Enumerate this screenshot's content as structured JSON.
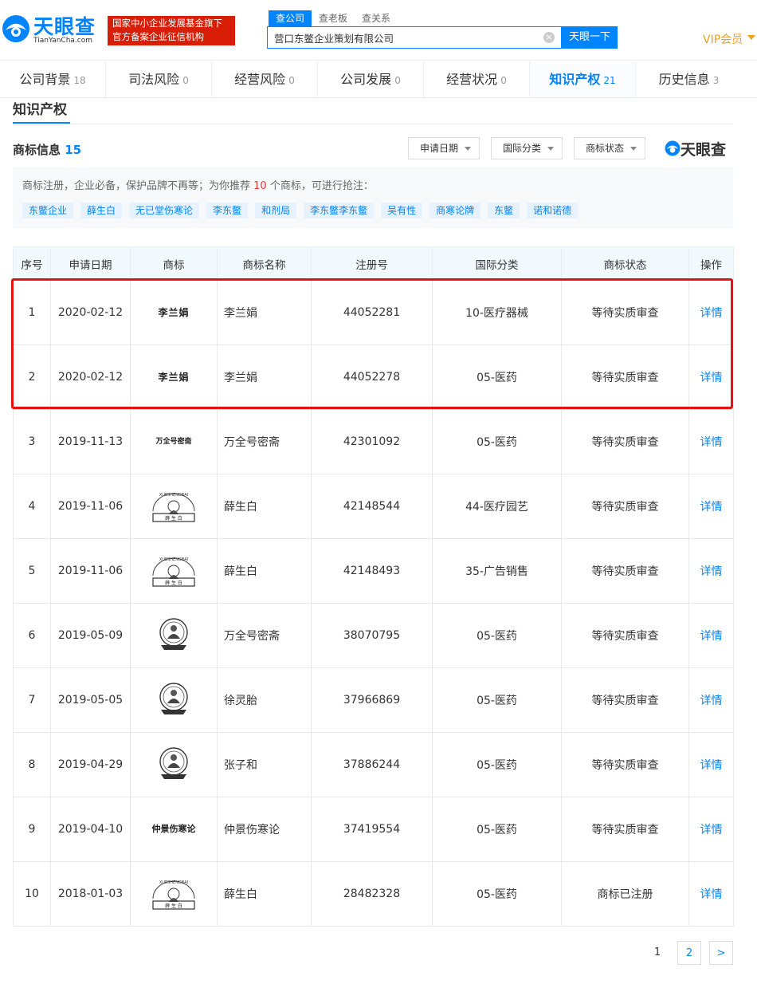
{
  "header": {
    "logo_text": "天眼查",
    "logo_sub": "TianYanCha.com",
    "badge_line1": "国家中小企业发展基金旗下",
    "badge_line2": "官方备案企业征信机构",
    "search_tabs": [
      "查公司",
      "查老板",
      "查关系"
    ],
    "search_value": "营口东鳖企业策划有限公司",
    "search_button": "天眼一下",
    "vip": "VIP会员"
  },
  "nav": [
    {
      "label": "公司背景",
      "count": "18"
    },
    {
      "label": "司法风险",
      "count": "0"
    },
    {
      "label": "经营风险",
      "count": "0"
    },
    {
      "label": "公司发展",
      "count": "0"
    },
    {
      "label": "经营状况",
      "count": "0"
    },
    {
      "label": "知识产权",
      "count": "21"
    },
    {
      "label": "历史信息",
      "count": "3"
    }
  ],
  "section": {
    "title": "知识产权",
    "tm_title": "商标信息",
    "tm_count": "15",
    "filters": [
      "申请日期",
      "国际分类",
      "商标状态"
    ],
    "brand_logo": "天眼查"
  },
  "recommend": {
    "text_before": "商标注册，企业必备，保护品牌不再等；为你推荐 ",
    "count": "10",
    "text_after": " 个商标，可进行抢注：",
    "tags": [
      "东鳖企业",
      "薛生白",
      "无已堂伤寒论",
      "李东鳖",
      "和剂局",
      "李东鳖李东鳖",
      "吴有性",
      "商寒论牌",
      "东鳖",
      "诺和诺德"
    ]
  },
  "table": {
    "headers": [
      "序号",
      "申请日期",
      "商标",
      "商标名称",
      "注册号",
      "国际分类",
      "商标状态",
      "操作"
    ],
    "rows": [
      {
        "no": "1",
        "date": "2020-02-12",
        "logo": "text-li",
        "logo_text": "李兰娟",
        "name": "李兰娟",
        "reg": "44052281",
        "cls": "10-医疗器械",
        "status": "等待实质审查",
        "op": "详情"
      },
      {
        "no": "2",
        "date": "2020-02-12",
        "logo": "text-li",
        "logo_text": "李兰娟",
        "name": "李兰娟",
        "reg": "44052278",
        "cls": "05-医药",
        "status": "等待实质审查",
        "op": "详情"
      },
      {
        "no": "3",
        "date": "2019-11-13",
        "logo": "text-small",
        "logo_text": "万全号密斋",
        "name": "万全号密斋",
        "reg": "42301092",
        "cls": "05-医药",
        "status": "等待实质审查",
        "op": "详情"
      },
      {
        "no": "4",
        "date": "2019-11-06",
        "logo": "xue",
        "logo_text": "",
        "name": "薛生白",
        "reg": "42148544",
        "cls": "44-医疗园艺",
        "status": "等待实质审查",
        "op": "详情"
      },
      {
        "no": "5",
        "date": "2019-11-06",
        "logo": "xue",
        "logo_text": "",
        "name": "薛生白",
        "reg": "42148493",
        "cls": "35-广告销售",
        "status": "等待实质审查",
        "op": "详情"
      },
      {
        "no": "6",
        "date": "2019-05-09",
        "logo": "round",
        "logo_text": "",
        "name": "万全号密斋",
        "reg": "38070795",
        "cls": "05-医药",
        "status": "等待实质审查",
        "op": "详情"
      },
      {
        "no": "7",
        "date": "2019-05-05",
        "logo": "round",
        "logo_text": "",
        "name": "徐灵胎",
        "reg": "37966869",
        "cls": "05-医药",
        "status": "等待实质审查",
        "op": "详情"
      },
      {
        "no": "8",
        "date": "2019-04-29",
        "logo": "round",
        "logo_text": "",
        "name": "张子和",
        "reg": "37886244",
        "cls": "05-医药",
        "status": "等待实质审查",
        "op": "详情"
      },
      {
        "no": "9",
        "date": "2019-04-10",
        "logo": "text-zhong",
        "logo_text": "仲景伤寒论",
        "name": "仲景伤寒论",
        "reg": "37419554",
        "cls": "05-医药",
        "status": "等待实质审查",
        "op": "详情"
      },
      {
        "no": "10",
        "date": "2018-01-03",
        "logo": "xue",
        "logo_text": "",
        "name": "薛生白",
        "reg": "28482328",
        "cls": "05-医药",
        "status": "商标已注册",
        "op": "详情"
      }
    ]
  },
  "pagination": {
    "current": "1",
    "next_page": "2",
    "next": ">"
  },
  "colors": {
    "accent": "#0084ff",
    "highlight": "#e8120c",
    "badge": "#d81e06"
  }
}
